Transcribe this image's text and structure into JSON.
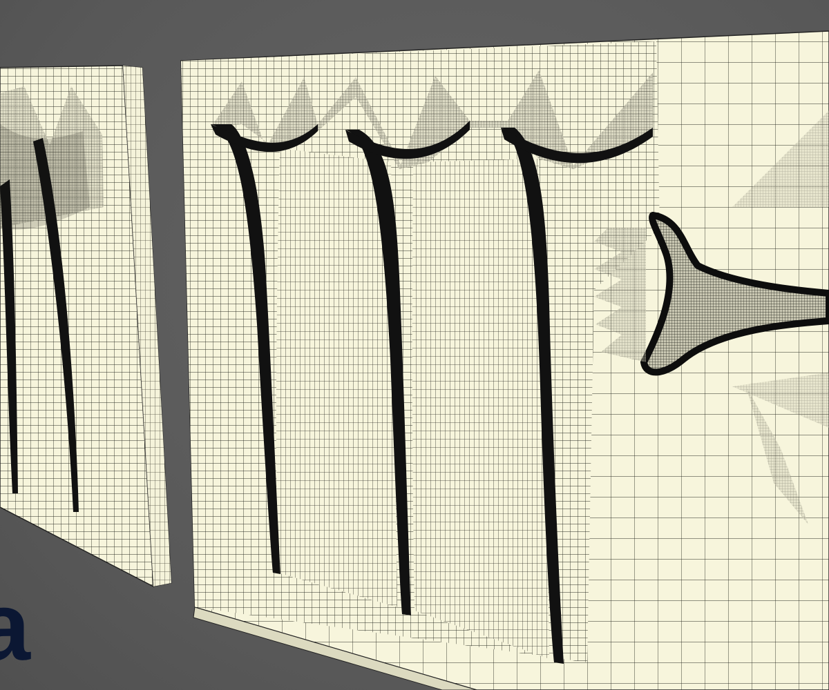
{
  "scene": {
    "background_color": "#5c5c5c",
    "mesh_surface_color": "#f7f5dc",
    "wire_color": "#222222",
    "groove_color": "#111111"
  },
  "panels": [
    {
      "name": "left-panel",
      "grooves": 2,
      "peaks": 3
    },
    {
      "name": "right-panel",
      "grooves": 3,
      "peaks": 7,
      "has_wing_hole": true
    }
  ],
  "logo": {
    "text": "a",
    "color": "#0b1733"
  }
}
